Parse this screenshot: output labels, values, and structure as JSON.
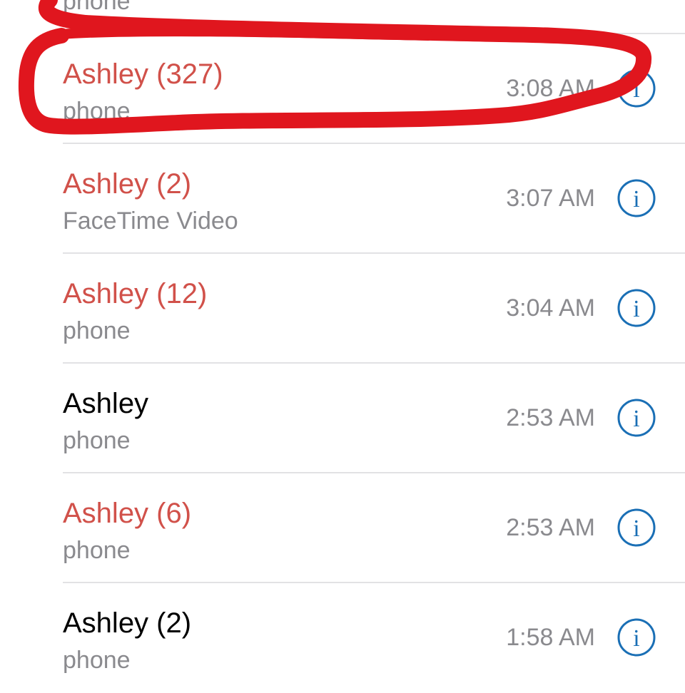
{
  "calls": [
    {
      "name": "",
      "type": "phone",
      "time": "",
      "missed": true,
      "partial": true
    },
    {
      "name": "Ashley (327)",
      "type": "phone",
      "time": "3:08 AM",
      "missed": true
    },
    {
      "name": "Ashley (2)",
      "type": "FaceTime Video",
      "time": "3:07 AM",
      "missed": true
    },
    {
      "name": "Ashley (12)",
      "type": "phone",
      "time": "3:04 AM",
      "missed": true
    },
    {
      "name": "Ashley",
      "type": "phone",
      "time": "2:53 AM",
      "missed": false
    },
    {
      "name": "Ashley (6)",
      "type": "phone",
      "time": "2:53 AM",
      "missed": true
    },
    {
      "name": "Ashley (2)",
      "type": "phone",
      "time": "1:58 AM",
      "missed": false
    }
  ],
  "info_icon": "info-circle-icon",
  "colors": {
    "missed": "#d1514a",
    "normal": "#000000",
    "secondary": "#8a8a8e",
    "accent": "#1a6fb5",
    "annotation": "#e0161e"
  }
}
